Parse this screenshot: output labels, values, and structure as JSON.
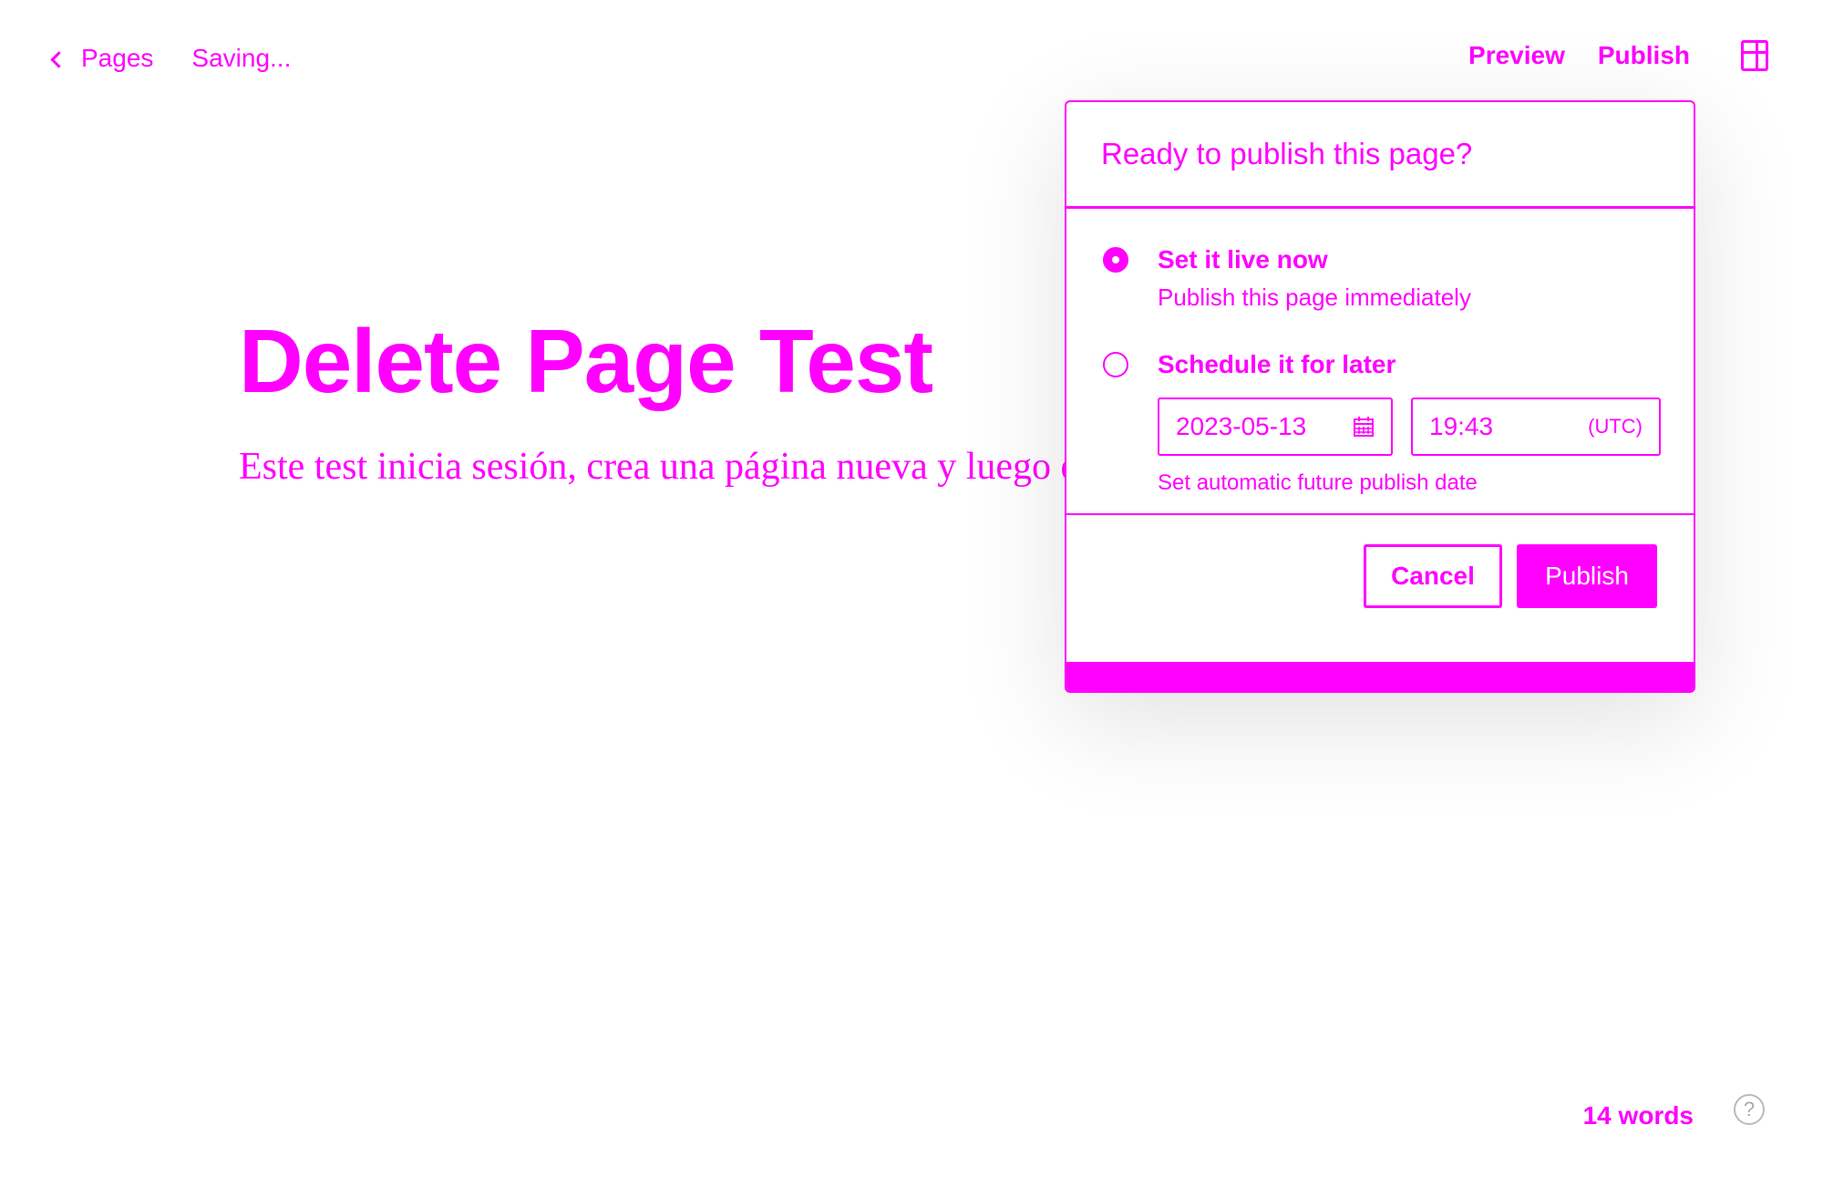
{
  "topbar": {
    "back_label": "Pages",
    "status": "Saving...",
    "preview_label": "Preview",
    "publish_label": "Publish"
  },
  "icons": {
    "back": "chevron-left-icon",
    "sidebar": "sidebar-icon",
    "calendar": "calendar-icon",
    "help": "help-icon"
  },
  "editor": {
    "title": "Delete Page Test",
    "body": "Este test inicia sesión, crea una página nueva y luego elimina la página creada."
  },
  "publish_panel": {
    "heading": "Ready to publish this page?",
    "option_now_title": "Set it live now",
    "option_now_desc": "Publish this page immediately",
    "option_later_title": "Schedule it for later",
    "date_value": "2023-05-13",
    "time_value": "19:43",
    "timezone": "(UTC)",
    "help_text": "Set automatic future publish date",
    "cancel_label": "Cancel",
    "publish_label": "Publish",
    "selected_option": "now"
  },
  "footer": {
    "word_count": "14 words",
    "help_glyph": "?"
  },
  "colors": {
    "accent": "#ff00ff",
    "background": "#ffffff"
  }
}
